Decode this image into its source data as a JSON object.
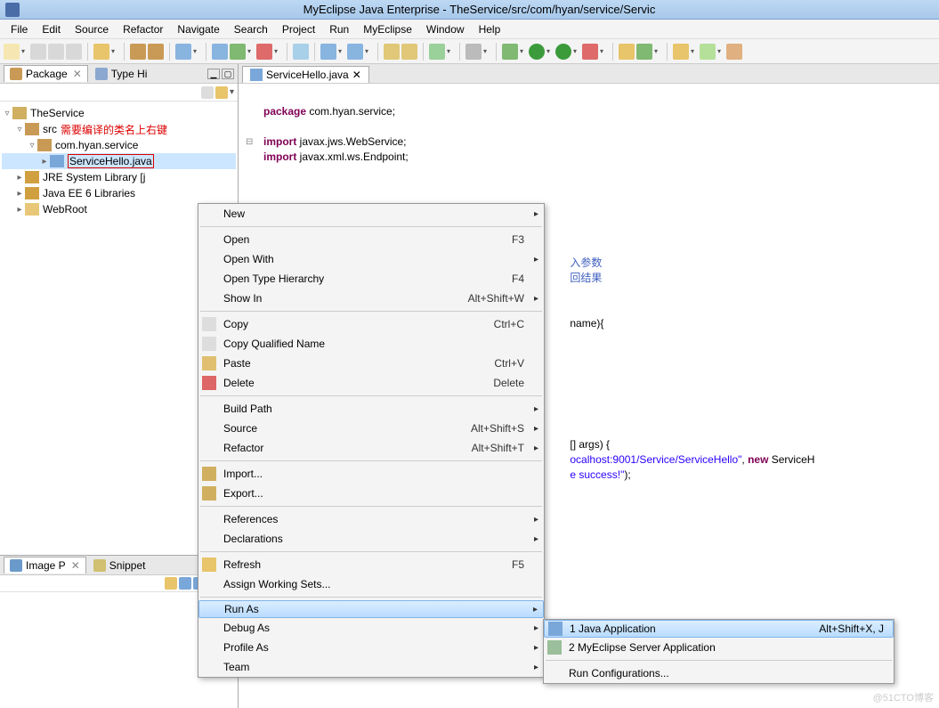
{
  "title": "MyEclipse Java Enterprise - TheService/src/com/hyan/service/Servic",
  "menus": [
    "File",
    "Edit",
    "Source",
    "Refactor",
    "Navigate",
    "Search",
    "Project",
    "Run",
    "MyEclipse",
    "Window",
    "Help"
  ],
  "views": {
    "pkg_tab": "Package",
    "type_tab": "Type Hi",
    "img_tab": "Image P",
    "snip_tab": "Snippet"
  },
  "tree": {
    "project": "TheService",
    "src": "src",
    "annot": "需要编译的类名上右键",
    "pkg": "com.hyan.service",
    "file": "ServiceHello.java",
    "jre": "JRE System Library [j",
    "jee": "Java EE 6 Libraries",
    "web": "WebRoot"
  },
  "editor": {
    "tab": "ServiceHello.java",
    "l1a": "package",
    "l1b": " com.hyan.service;",
    "l2a": "import",
    "l2b": " javax.jws.WebService;",
    "l3a": "import",
    "l3b": " javax.xml.ws.Endpoint;",
    "comm1": "入参数",
    "comm2": "回结果",
    "frag1": "name){",
    "frag2": "[] args) {",
    "frag3a": "ocalhost:9001/Service/ServiceHello\"",
    "frag3b": ", ",
    "frag3c": "new",
    "frag3d": " ServiceH",
    "frag4": "e success!\"",
    "frag4b": ");"
  },
  "ctx": {
    "new": "New",
    "open": "Open",
    "open_sc": "F3",
    "openwith": "Open With",
    "openhier": "Open Type Hierarchy",
    "openhier_sc": "F4",
    "showin": "Show In",
    "showin_sc": "Alt+Shift+W",
    "copy": "Copy",
    "copy_sc": "Ctrl+C",
    "copyq": "Copy Qualified Name",
    "paste": "Paste",
    "paste_sc": "Ctrl+V",
    "delete": "Delete",
    "delete_sc": "Delete",
    "build": "Build Path",
    "source": "Source",
    "source_sc": "Alt+Shift+S",
    "refactor": "Refactor",
    "refactor_sc": "Alt+Shift+T",
    "import": "Import...",
    "export": "Export...",
    "refs": "References",
    "decls": "Declarations",
    "refresh": "Refresh",
    "refresh_sc": "F5",
    "assign": "Assign Working Sets...",
    "runas": "Run As",
    "debugas": "Debug As",
    "profileas": "Profile As",
    "team": "Team"
  },
  "sub": {
    "java": "1 Java Application",
    "java_sc": "Alt+Shift+X, J",
    "server": "2 MyEclipse Server Application",
    "runconf": "Run Configurations..."
  },
  "watermark": "@51CTO博客"
}
